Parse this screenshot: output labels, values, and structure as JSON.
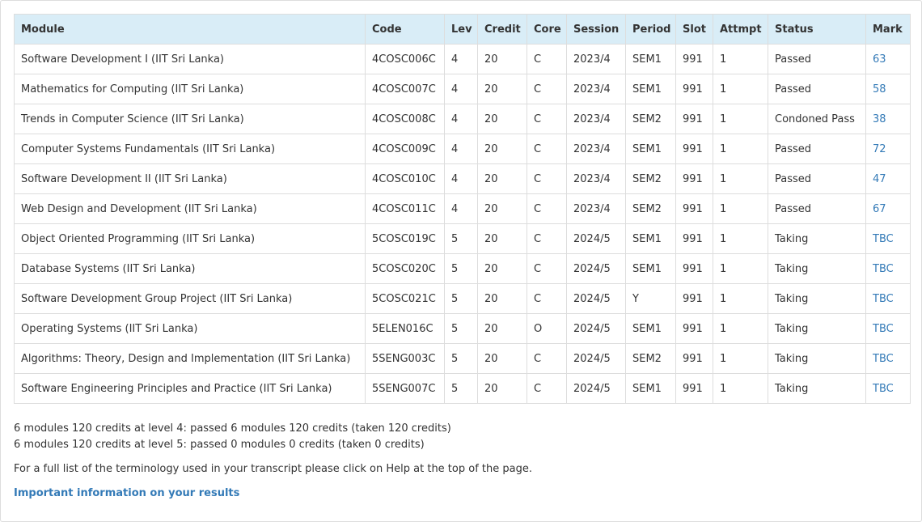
{
  "table": {
    "headers": [
      "Module",
      "Code",
      "Lev",
      "Credit",
      "Core",
      "Session",
      "Period",
      "Slot",
      "Attmpt",
      "Status",
      "Mark"
    ],
    "rows": [
      {
        "module": "Software Development I (IIT Sri Lanka)",
        "code": "4COSC006C",
        "lev": "4",
        "credit": "20",
        "core": "C",
        "session": "2023/4",
        "period": "SEM1",
        "slot": "991",
        "attempt": "1",
        "status": "Passed",
        "mark": "63"
      },
      {
        "module": "Mathematics for Computing (IIT Sri Lanka)",
        "code": "4COSC007C",
        "lev": "4",
        "credit": "20",
        "core": "C",
        "session": "2023/4",
        "period": "SEM1",
        "slot": "991",
        "attempt": "1",
        "status": "Passed",
        "mark": "58"
      },
      {
        "module": "Trends in Computer Science (IIT Sri Lanka)",
        "code": "4COSC008C",
        "lev": "4",
        "credit": "20",
        "core": "C",
        "session": "2023/4",
        "period": "SEM2",
        "slot": "991",
        "attempt": "1",
        "status": "Condoned Pass",
        "mark": "38"
      },
      {
        "module": "Computer Systems Fundamentals (IIT Sri Lanka)",
        "code": "4COSC009C",
        "lev": "4",
        "credit": "20",
        "core": "C",
        "session": "2023/4",
        "period": "SEM1",
        "slot": "991",
        "attempt": "1",
        "status": "Passed",
        "mark": "72"
      },
      {
        "module": "Software Development II (IIT Sri Lanka)",
        "code": "4COSC010C",
        "lev": "4",
        "credit": "20",
        "core": "C",
        "session": "2023/4",
        "period": "SEM2",
        "slot": "991",
        "attempt": "1",
        "status": "Passed",
        "mark": "47"
      },
      {
        "module": "Web Design and Development (IIT Sri Lanka)",
        "code": "4COSC011C",
        "lev": "4",
        "credit": "20",
        "core": "C",
        "session": "2023/4",
        "period": "SEM2",
        "slot": "991",
        "attempt": "1",
        "status": "Passed",
        "mark": "67"
      },
      {
        "module": "Object Oriented Programming (IIT Sri Lanka)",
        "code": "5COSC019C",
        "lev": "5",
        "credit": "20",
        "core": "C",
        "session": "2024/5",
        "period": "SEM1",
        "slot": "991",
        "attempt": "1",
        "status": "Taking",
        "mark": "TBC"
      },
      {
        "module": "Database Systems (IIT Sri Lanka)",
        "code": "5COSC020C",
        "lev": "5",
        "credit": "20",
        "core": "C",
        "session": "2024/5",
        "period": "SEM1",
        "slot": "991",
        "attempt": "1",
        "status": "Taking",
        "mark": "TBC"
      },
      {
        "module": "Software Development Group Project (IIT Sri Lanka)",
        "code": "5COSC021C",
        "lev": "5",
        "credit": "20",
        "core": "C",
        "session": "2024/5",
        "period": "Y",
        "slot": "991",
        "attempt": "1",
        "status": "Taking",
        "mark": "TBC"
      },
      {
        "module": "Operating Systems (IIT Sri Lanka)",
        "code": "5ELEN016C",
        "lev": "5",
        "credit": "20",
        "core": "O",
        "session": "2024/5",
        "period": "SEM1",
        "slot": "991",
        "attempt": "1",
        "status": "Taking",
        "mark": "TBC"
      },
      {
        "module": "Algorithms: Theory, Design and Implementation (IIT Sri Lanka)",
        "code": "5SENG003C",
        "lev": "5",
        "credit": "20",
        "core": "C",
        "session": "2024/5",
        "period": "SEM2",
        "slot": "991",
        "attempt": "1",
        "status": "Taking",
        "mark": "TBC"
      },
      {
        "module": "Software Engineering Principles and Practice (IIT Sri Lanka)",
        "code": "5SENG007C",
        "lev": "5",
        "credit": "20",
        "core": "C",
        "session": "2024/5",
        "period": "SEM1",
        "slot": "991",
        "attempt": "1",
        "status": "Taking",
        "mark": "TBC"
      }
    ]
  },
  "summary": {
    "level4": "6 modules 120 credits at level 4: passed 6 modules 120 credits (taken 120 credits)",
    "level5": "6 modules 120 credits at level 5: passed 0 modules 0 credits (taken 0 credits)"
  },
  "terminology_note": "For a full list of the terminology used in your transcript please click on Help at the top of the page.",
  "info_link": "Important information on your results",
  "colors": {
    "header_bg": "#d9edf7",
    "link": "#337ab7",
    "border": "#dddddd",
    "text": "#333333"
  }
}
